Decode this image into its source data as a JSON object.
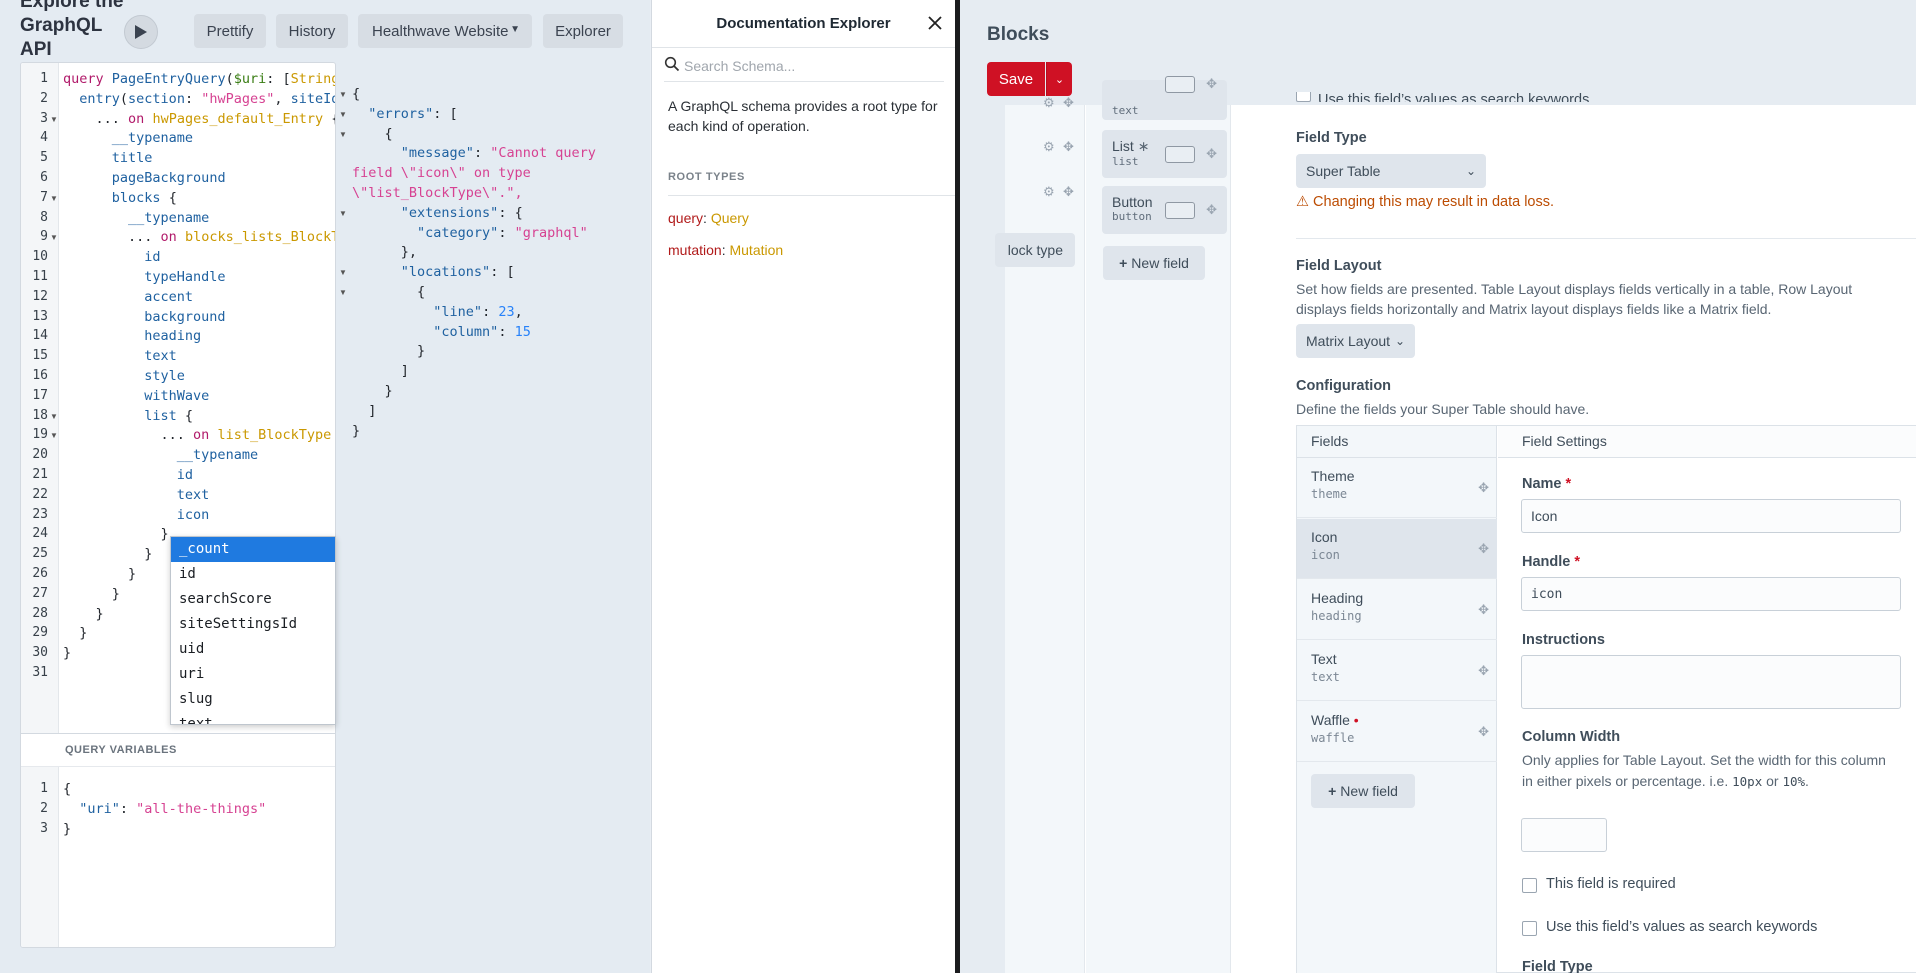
{
  "graphiql": {
    "title": "Explore the GraphQL API",
    "buttons": {
      "prettify": "Prettify",
      "history": "History",
      "site": "Healthwave Website",
      "explorer": "Explorer"
    },
    "query_lines": [
      "query PageEntryQuery($uri: [String]",
      "  entry(section: \"hwPages\", siteId:",
      "    ... on hwPages_default_Entry {",
      "      __typename",
      "      title",
      "      pageBackground",
      "      blocks {",
      "        __typename",
      "        ... on blocks_lists_BlockTy",
      "          id",
      "          typeHandle",
      "          accent",
      "          background",
      "          heading",
      "          text",
      "          style",
      "          withWave",
      "          list {",
      "            ... on list_BlockType {",
      "              __typename",
      "              id",
      "              text",
      "              icon",
      "            }",
      "          }",
      "        }",
      "      }",
      "    }",
      "  }",
      "}",
      ""
    ],
    "autocomplete": [
      "_count",
      "id",
      "searchScore",
      "siteSettingsId",
      "uid",
      "uri",
      "slug",
      "text"
    ],
    "query_variables_label": "QUERY VARIABLES",
    "variables_lines": [
      "{",
      "  \"uri\": \"all-the-things\"",
      "}"
    ],
    "result_lines": [
      "{",
      "  \"errors\": [",
      "    {",
      "      \"message\": \"Cannot query",
      "field \\\"icon\\\" on type",
      "\\\"list_BlockType\\\".\",",
      "      \"extensions\": {",
      "        \"category\": \"graphql\"",
      "      },",
      "      \"locations\": [",
      "        {",
      "          \"line\": 23,",
      "          \"column\": 15",
      "        }",
      "      ]",
      "    }",
      "  ]",
      "}"
    ]
  },
  "docs": {
    "title": "Documentation Explorer",
    "search_placeholder": "Search Schema...",
    "description": "A GraphQL schema provides a root type for each kind of operation.",
    "root_types_label": "ROOT TYPES",
    "roots": [
      {
        "key": "query",
        "type": "Query"
      },
      {
        "key": "mutation",
        "type": "Mutation"
      }
    ]
  },
  "craft": {
    "title": "Blocks",
    "save": "Save",
    "top_blocks": [
      {
        "name": "",
        "handle": "text"
      },
      {
        "name": "List",
        "handle": "list"
      },
      {
        "name": "Button",
        "handle": "button"
      }
    ],
    "new_block_type": "lock type",
    "new_field": "New field",
    "field_type_label": "Field Type",
    "field_type_value": "Super Table",
    "warning": "Changing this may result in data loss.",
    "field_layout_label": "Field Layout",
    "field_layout_desc": "Set how fields are presented. Table Layout displays fields vertically in a table, Row Layout displays fields horizontally and Matrix layout displays fields like a Matrix field.",
    "field_layout_value": "Matrix Layout",
    "configuration_label": "Configuration",
    "configuration_desc": "Define the fields your Super Table should have.",
    "fields_header": "Fields",
    "settings_header": "Field Settings",
    "fields": [
      {
        "name": "Theme",
        "handle": "theme",
        "required": false
      },
      {
        "name": "Icon",
        "handle": "icon",
        "required": false
      },
      {
        "name": "Heading",
        "handle": "heading",
        "required": false
      },
      {
        "name": "Text",
        "handle": "text",
        "required": false
      },
      {
        "name": "Waffle",
        "handle": "waffle",
        "required": true
      }
    ],
    "settings": {
      "name_label": "Name",
      "name_value": "Icon",
      "handle_label": "Handle",
      "handle_value": "icon",
      "instructions_label": "Instructions",
      "instructions_value": "",
      "column_width_label": "Column Width",
      "column_width_desc_1": "Only applies for Table Layout. Set the width for this column in either pixels or percentage. i.e.",
      "column_width_code_1": "10px",
      "column_width_or": "or",
      "column_width_code_2": "10%",
      "column_width_value": "",
      "required_label": "This field is required",
      "search_keywords_label": "Use this field’s values as search keywords",
      "field_type_label": "Field Type"
    },
    "partial_top_text": "Use this field’s values as search keywords"
  },
  "colors": {
    "accent": "#cf1124",
    "warning": "#bc4c02",
    "selection": "#1f7ae0"
  }
}
